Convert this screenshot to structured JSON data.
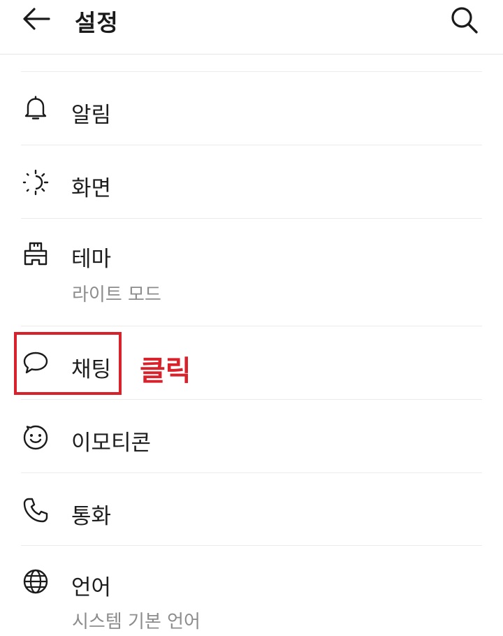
{
  "header": {
    "title": "설정",
    "back_icon": "arrow-left-icon",
    "search_icon": "search-icon"
  },
  "settings": [
    {
      "id": "notifications",
      "label": "알림",
      "icon": "bell-icon"
    },
    {
      "id": "display",
      "label": "화면",
      "icon": "brightness-icon"
    },
    {
      "id": "theme",
      "label": "테마",
      "sub": "라이트 모드",
      "icon": "paint-brush-icon"
    },
    {
      "id": "chat",
      "label": "채팅",
      "icon": "chat-bubble-icon"
    },
    {
      "id": "emoticon",
      "label": "이모티콘",
      "icon": "smiley-icon"
    },
    {
      "id": "call",
      "label": "통화",
      "icon": "phone-icon"
    },
    {
      "id": "language",
      "label": "언어",
      "sub": "시스템 기본 언어",
      "icon": "globe-icon"
    }
  ],
  "annotation": {
    "text": "클릭",
    "color": "#d9212b"
  }
}
